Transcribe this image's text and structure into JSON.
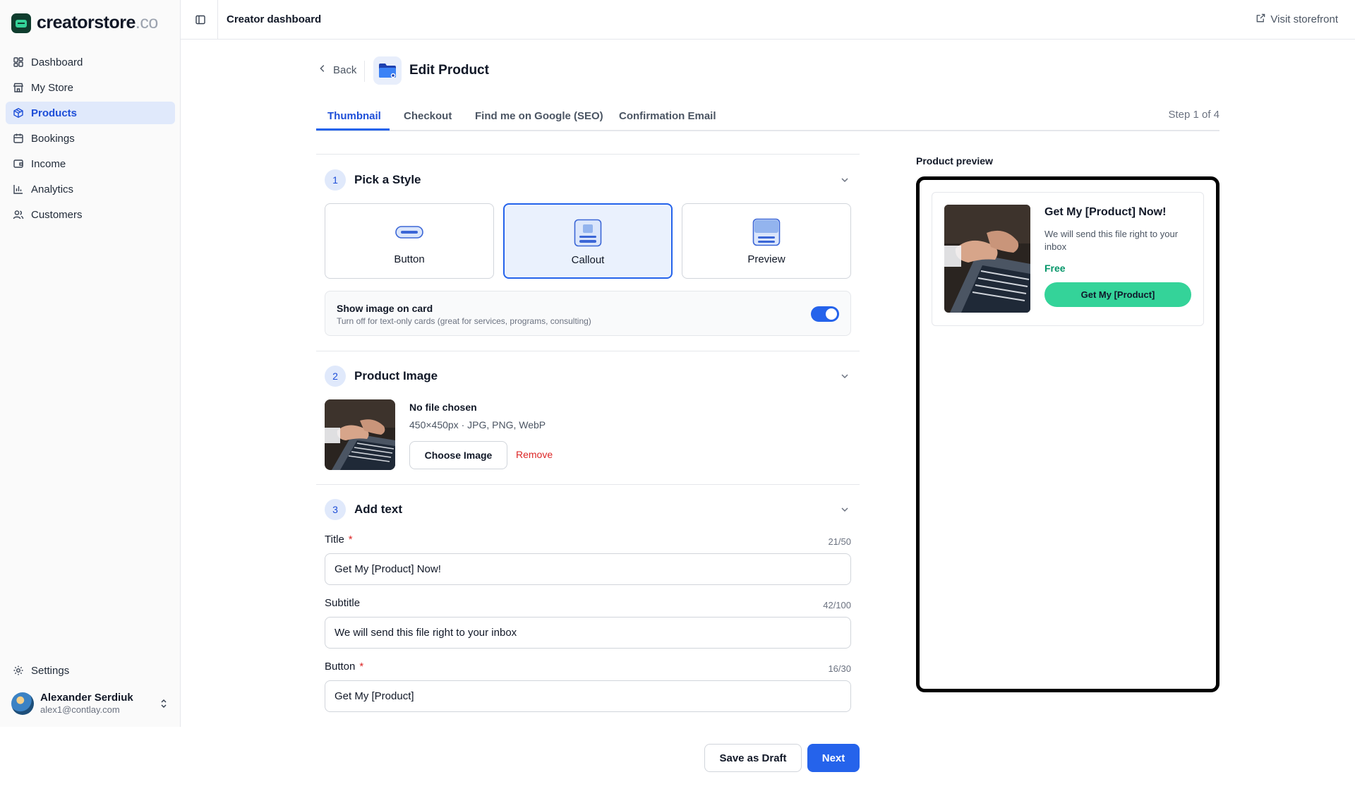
{
  "brand": {
    "name": "creatorstore",
    "tld": ".co"
  },
  "sidebar": {
    "items": [
      {
        "label": "Dashboard",
        "icon": "dashboard-icon"
      },
      {
        "label": "My Store",
        "icon": "store-icon"
      },
      {
        "label": "Products",
        "icon": "box-icon",
        "active": true
      },
      {
        "label": "Bookings",
        "icon": "calendar-icon"
      },
      {
        "label": "Income",
        "icon": "wallet-icon"
      },
      {
        "label": "Analytics",
        "icon": "bar-chart-icon"
      },
      {
        "label": "Customers",
        "icon": "users-icon"
      }
    ],
    "settings_label": "Settings",
    "user": {
      "name": "Alexander Serdiuk",
      "email": "alex1@contlay.com"
    }
  },
  "topbar": {
    "title": "Creator dashboard",
    "visit_label": "Visit storefront"
  },
  "page": {
    "back_label": "Back",
    "title": "Edit Product"
  },
  "tabs": {
    "items": [
      {
        "label": "Thumbnail",
        "active": true
      },
      {
        "label": "Checkout"
      },
      {
        "label": "Find me on Google (SEO)"
      },
      {
        "label": "Confirmation Email"
      }
    ],
    "step": "Step 1 of 4"
  },
  "sections": {
    "style": {
      "number": "1",
      "title": "Pick a Style",
      "options": [
        {
          "label": "Button"
        },
        {
          "label": "Callout",
          "selected": true
        },
        {
          "label": "Preview"
        }
      ],
      "toggle": {
        "title": "Show image on card",
        "subtitle": "Turn off for text-only cards (great for services, programs, consulting)",
        "on": true
      }
    },
    "image": {
      "number": "2",
      "title": "Product Image",
      "file_status": "No file chosen",
      "hint": "450×450px · JPG, PNG, WebP",
      "choose_label": "Choose Image",
      "remove_label": "Remove"
    },
    "text": {
      "number": "3",
      "title": "Add text",
      "fields": {
        "title": {
          "label": "Title",
          "required": "*",
          "counter": "21/50",
          "value": "Get My [Product] Now!"
        },
        "subtitle": {
          "label": "Subtitle",
          "counter": "42/100",
          "value": "We will send this file right to your inbox"
        },
        "button": {
          "label": "Button",
          "required": "*",
          "counter": "16/30",
          "value": "Get My [Product]"
        }
      }
    }
  },
  "actions": {
    "draft_label": "Save as Draft",
    "next_label": "Next"
  },
  "preview": {
    "label": "Product preview",
    "card": {
      "title": "Get My [Product] Now!",
      "subtitle": "We will send this file right to your inbox",
      "price": "Free",
      "button": "Get My [Product]"
    }
  },
  "colors": {
    "accent": "#2563eb",
    "cta": "#34d399",
    "price": "#059669",
    "danger": "#dc2626"
  }
}
